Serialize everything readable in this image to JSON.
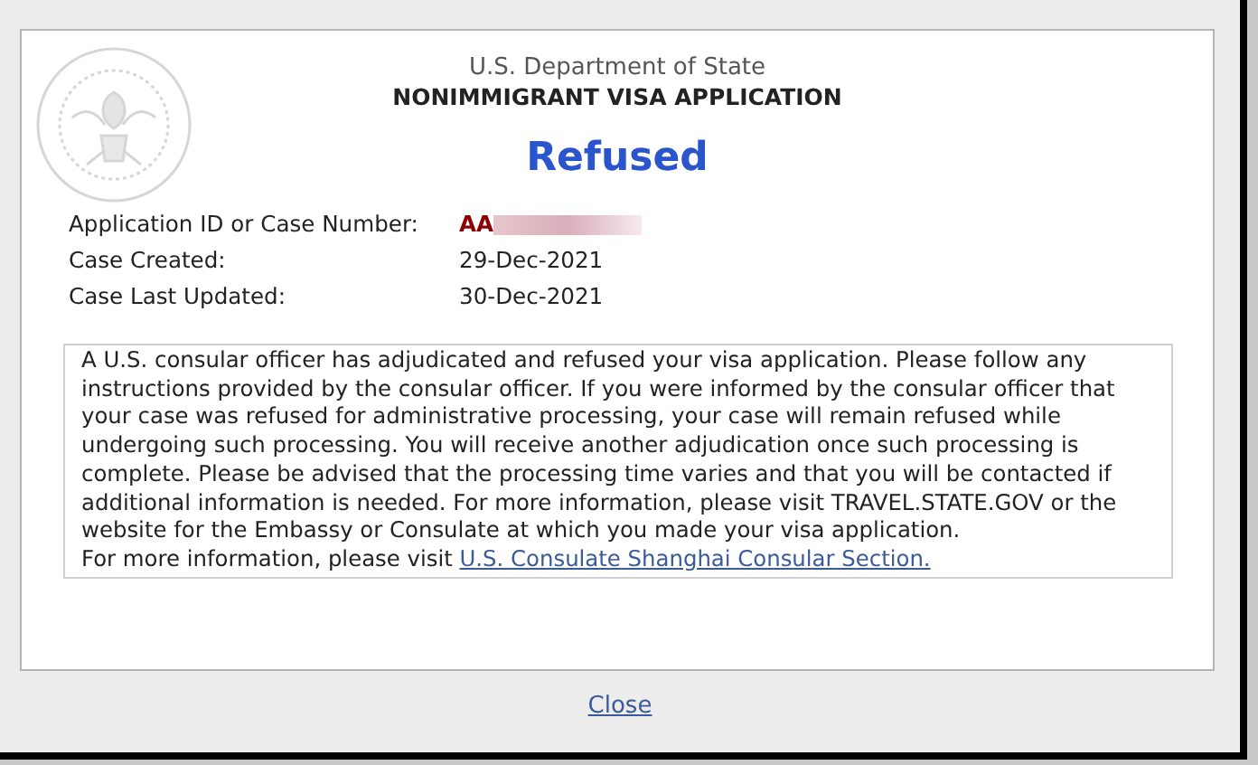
{
  "header": {
    "department": "U.S. Department of State",
    "form_title": "NONIMMIGRANT VISA APPLICATION",
    "status": "Refused"
  },
  "fields": [
    {
      "label": "Application ID or Case Number:",
      "value": "AA",
      "redacted": true
    },
    {
      "label": "Case Created:",
      "value": "29-Dec-2021",
      "redacted": false
    },
    {
      "label": "Case Last Updated:",
      "value": "30-Dec-2021",
      "redacted": false
    }
  ],
  "message": {
    "body": "A U.S. consular officer has adjudicated and refused your visa application. Please follow any instructions provided by the consular officer. If you were informed by the consular officer that your case was refused for administrative processing, your case will remain refused while undergoing such processing. You will receive another adjudication once such processing is complete. Please be advised that the processing time varies and that you will be contacted if additional information is needed. For more information, please visit TRAVEL.STATE.GOV or the website for the Embassy or Consulate at which you made your visa application.",
    "more_info": "For more information, please visit",
    "link": "U.S. Consulate Shanghai Consular Section."
  },
  "close_link": "Close"
}
